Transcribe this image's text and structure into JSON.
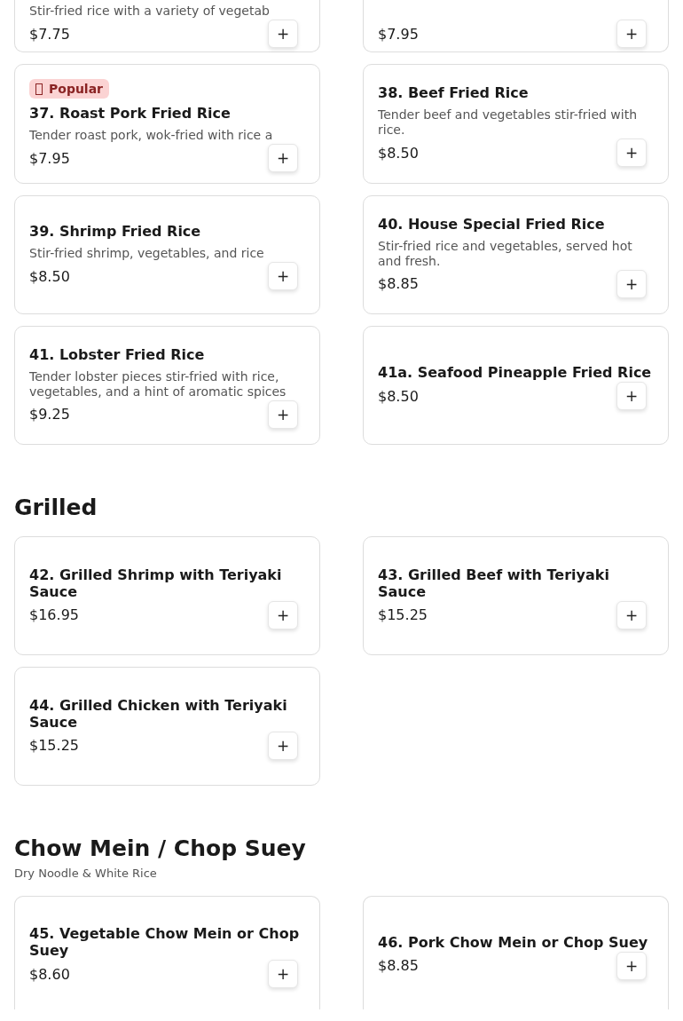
{
  "sections": [
    {
      "items": [
        {
          "description": "Stir-fried rice with a variety of vegetab",
          "price": "$7.75"
        },
        {
          "price": "$7.95"
        },
        {
          "badge": "Popular",
          "name": "37. Roast Pork Fried Rice",
          "description": "Tender roast pork, wok-fried with rice a",
          "price": "$7.95"
        },
        {
          "name": "38. Beef Fried Rice",
          "description": "Tender beef and vegetables stir-fried with rice.",
          "price": "$8.50"
        },
        {
          "name": "39. Shrimp Fried Rice",
          "description": "Stir-fried shrimp, vegetables, and rice",
          "price": "$8.50"
        },
        {
          "name": "40. House Special Fried Rice",
          "description": "Stir-fried rice and vegetables, served hot and fresh.",
          "price": "$8.85"
        },
        {
          "name": "41. Lobster Fried Rice",
          "description": "Tender lobster pieces stir-fried with rice, vegetables, and a hint of aromatic spices",
          "price": "$9.25"
        },
        {
          "name": "41a. Seafood Pineapple Fried Rice",
          "price": "$8.50"
        }
      ]
    },
    {
      "title": "Grilled",
      "items": [
        {
          "name": "42. Grilled Shrimp with Teriyaki Sauce",
          "price": "$16.95"
        },
        {
          "name": "43. Grilled Beef with Teriyaki Sauce",
          "price": "$15.25"
        },
        {
          "name": "44. Grilled Chicken with Teriyaki Sauce",
          "price": "$15.25"
        }
      ]
    },
    {
      "title": "Chow Mein / Chop Suey",
      "subtitle": "Dry Noodle & White Rice",
      "items": [
        {
          "name": "45. Vegetable Chow Mein or Chop Suey",
          "price": "$8.60"
        },
        {
          "name": "46. Pork Chow Mein or Chop Suey",
          "price": "$8.85"
        }
      ]
    }
  ],
  "add_button": "+"
}
